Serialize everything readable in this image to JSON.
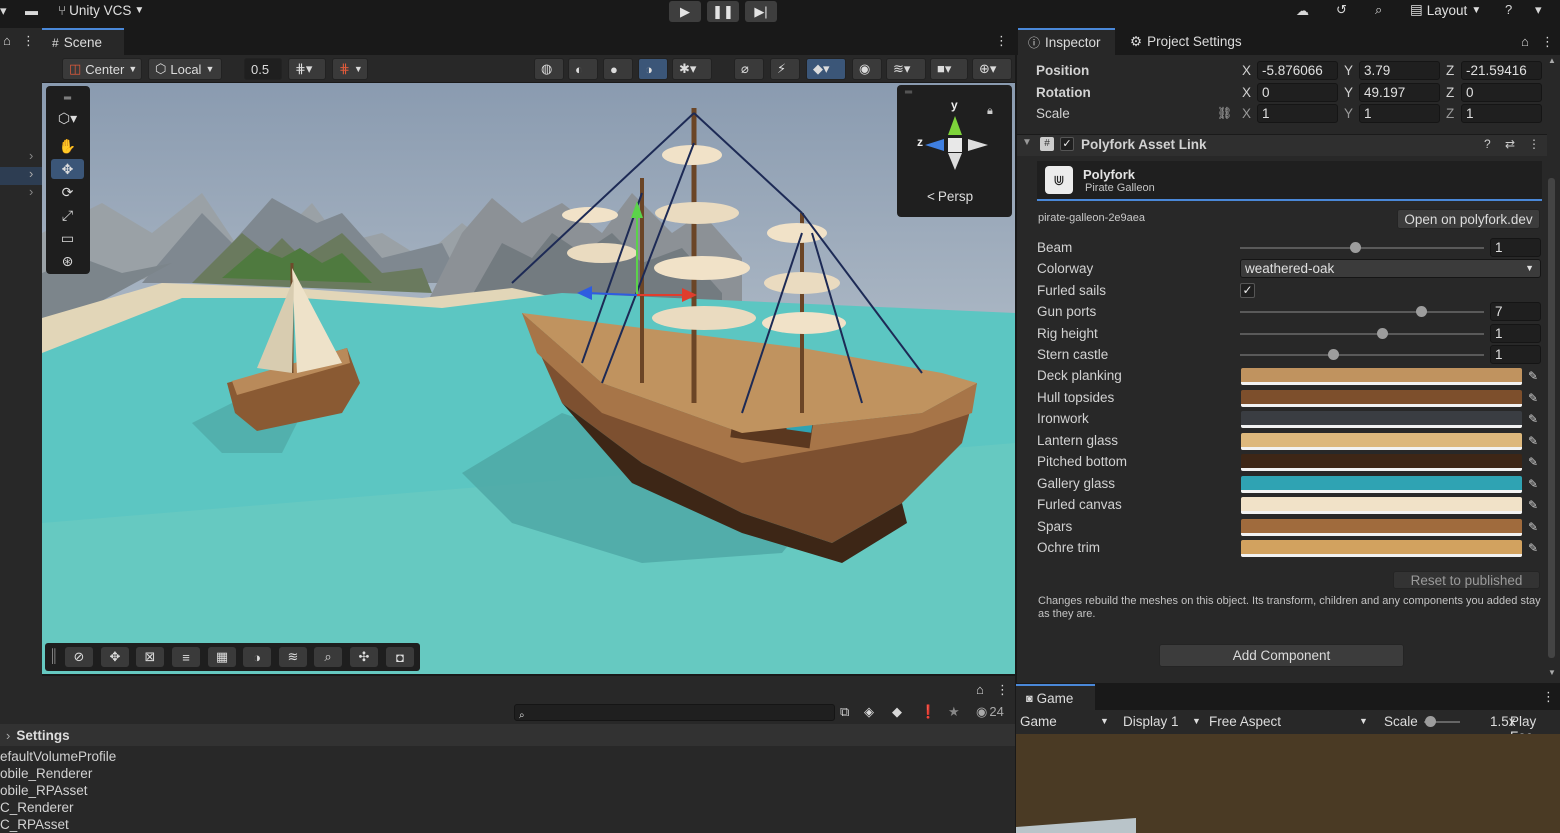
{
  "topbar": {
    "vcs_label": "Unity VCS",
    "layout_label": "Layout"
  },
  "scene": {
    "tab_label": "Scene",
    "pivot_label": "Center",
    "space_label": "Local",
    "snap_value": "0.5",
    "persp_label": "Persp",
    "gizmo_axes": {
      "y": "y",
      "z": "z"
    }
  },
  "inspector": {
    "tab_inspector": "Inspector",
    "tab_project_settings": "Project Settings",
    "transform": {
      "position_label": "Position",
      "rotation_label": "Rotation",
      "scale_label": "Scale",
      "axis_x": "X",
      "axis_y": "Y",
      "axis_z": "Z",
      "position": {
        "x": "-5.876066",
        "y": "3.79",
        "z": "-21.59416"
      },
      "rotation": {
        "x": "0",
        "y": "49.197",
        "z": "0"
      },
      "scale": {
        "x": "1",
        "y": "1",
        "z": "1"
      }
    },
    "component": {
      "title": "Polyfork Asset Link",
      "brand": "Polyfork",
      "asset_name": "Pirate Galleon",
      "asset_id": "pirate-galleon-2e9aea",
      "open_button": "Open on polyfork.dev",
      "sliders": [
        {
          "label": "Beam",
          "value": "1",
          "fraction": 0.47
        },
        {
          "label": "Gun ports",
          "value": "7",
          "fraction": 0.74
        },
        {
          "label": "Rig height",
          "value": "1",
          "fraction": 0.58
        },
        {
          "label": "Stern castle",
          "value": "1",
          "fraction": 0.38
        }
      ],
      "colorway_label": "Colorway",
      "colorway_value": "weathered-oak",
      "furled_label": "Furled sails",
      "furled_checked": true,
      "colors": [
        {
          "label": "Deck planking",
          "hex": "#c0935f"
        },
        {
          "label": "Hull topsides",
          "hex": "#7d4f2c"
        },
        {
          "label": "Ironwork",
          "hex": "#3a3d42"
        },
        {
          "label": "Lantern glass",
          "hex": "#ddb87c"
        },
        {
          "label": "Pitched bottom",
          "hex": "#3d2616"
        },
        {
          "label": "Gallery glass",
          "hex": "#2fa3b3"
        },
        {
          "label": "Furled canvas",
          "hex": "#f1e2c8"
        },
        {
          "label": "Spars",
          "hex": "#a06b3d"
        },
        {
          "label": "Ochre trim",
          "hex": "#d2a25f"
        }
      ],
      "reset_button": "Reset to published",
      "note": "Changes rebuild the meshes on this object. Its transform, children and any components you added stay as they are."
    },
    "add_component": "Add Component"
  },
  "project": {
    "folder": "Settings",
    "hidden_count": "24",
    "items": [
      "efaultVolumeProfile",
      "obile_Renderer",
      "obile_RPAsset",
      "C_Renderer",
      "C_RPAsset"
    ]
  },
  "game": {
    "tab_label": "Game",
    "mode": "Game",
    "display": "Display 1",
    "aspect": "Free Aspect",
    "scale_label": "Scale",
    "scale_value": "1.5x",
    "play_focus": "Play Foc"
  }
}
